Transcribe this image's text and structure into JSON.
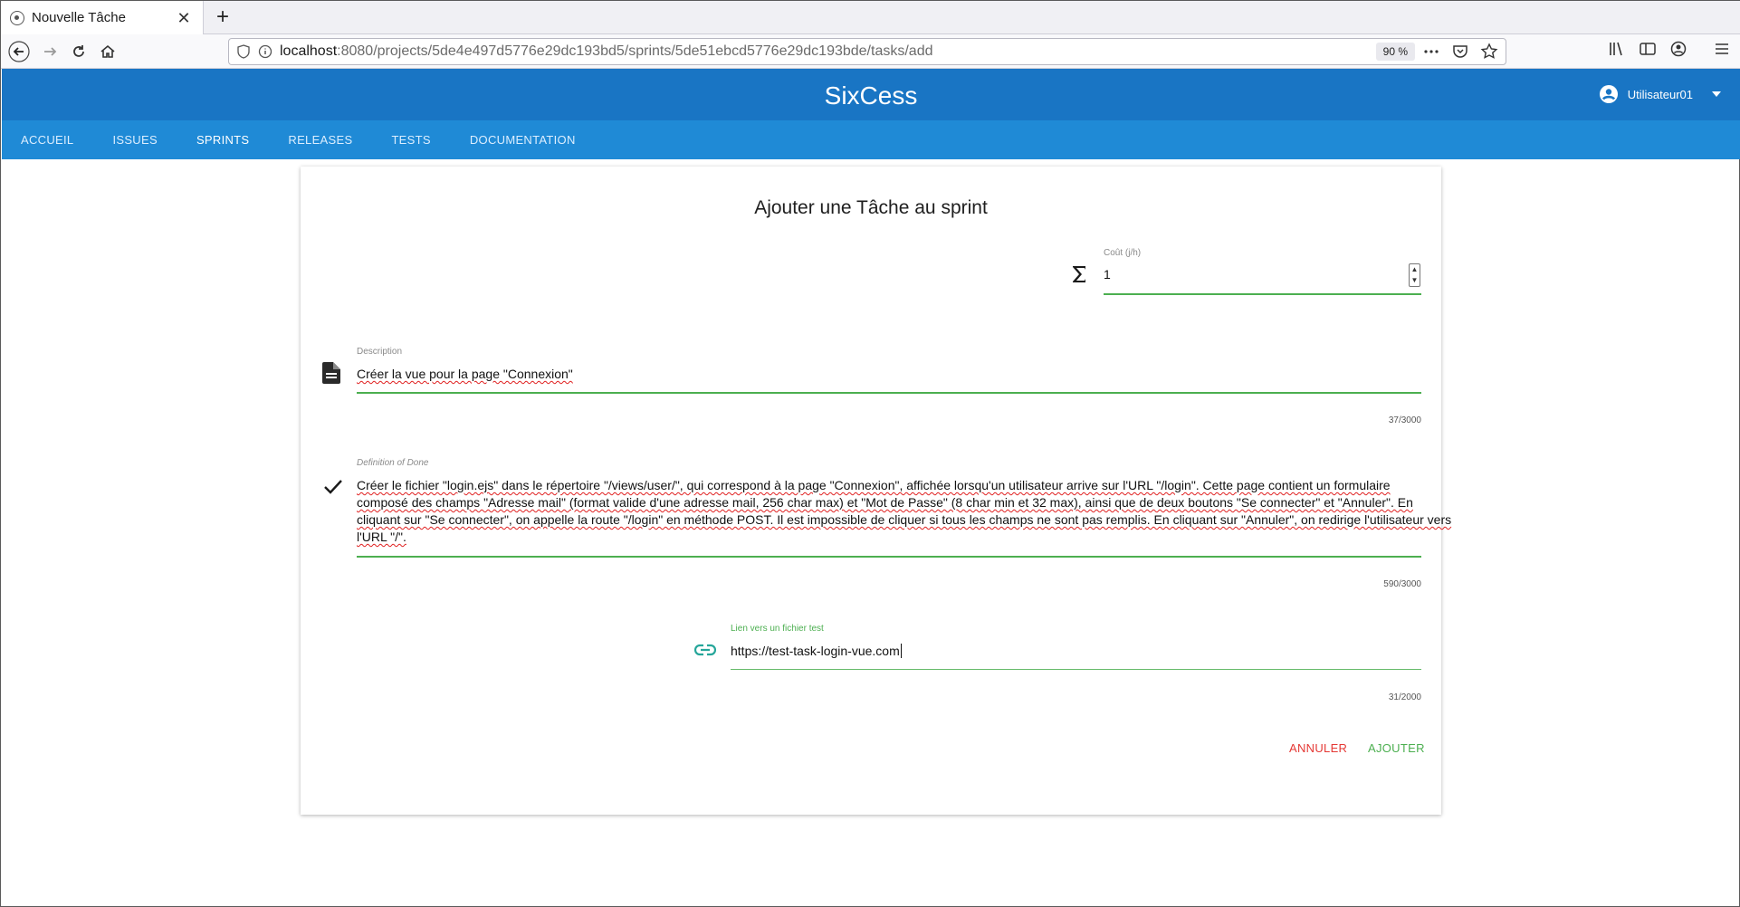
{
  "browser": {
    "tab_title": "Nouvelle Tâche",
    "url_host": "localhost",
    "url_rest": ":8080/projects/5de4e497d5776e29dc193bd5/sprints/5de51ebcd5776e29dc193bde/tasks/add",
    "zoom": "90 %"
  },
  "header": {
    "app_title": "SixCess",
    "user_name": "Utilisateur01"
  },
  "nav": {
    "items": [
      "ACCUEIL",
      "ISSUES",
      "SPRINTS",
      "RELEASES",
      "TESTS",
      "DOCUMENTATION"
    ],
    "active": "SPRINTS"
  },
  "form": {
    "title": "Ajouter une Tâche au sprint",
    "cost": {
      "label": "Coût (j/h)",
      "value": "1"
    },
    "description": {
      "label": "Description",
      "value": "Créer la vue pour la page \"Connexion\"",
      "counter": "37/3000"
    },
    "dod": {
      "label": "Definition of Done",
      "lines": [
        "Créer le fichier \"login.ejs\" dans le répertoire \"/views/user/\", qui correspond à la page \"Connexion\", affichée lorsqu'un utilisateur arrive sur l'URL \"/login\". Cette page contient un formulaire",
        "composé des champs \"Adresse mail\" (format valide d'une adresse mail, 256 char max) et \"Mot de Passe\" (8 char min et 32 max), ainsi que de deux boutons \"Se connecter\" et \"Annuler\". En",
        "cliquant sur \"Se connecter\", on appelle la route \"/login\" en méthode POST. Il est impossible de cliquer si tous les champs ne sont pas remplis. En cliquant sur \"Annuler\", on redirige l'utilisateur vers",
        "l'URL \"/\"."
      ],
      "counter": "590/3000"
    },
    "test_link": {
      "label": "Lien vers un fichier test",
      "value": "https://test-task-login-vue.com",
      "counter": "31/2000"
    },
    "cancel_label": "ANNULER",
    "submit_label": "AJOUTER"
  },
  "colors": {
    "header": "#1975c4",
    "nav": "#1f8ad6",
    "accent_green": "#4caf50",
    "cancel_red": "#e53935"
  },
  "icons": {
    "cost": "sigma-icon",
    "description": "document-icon",
    "dod": "checkmark-icon",
    "test_link": "link-icon",
    "user": "account-circle-icon"
  }
}
